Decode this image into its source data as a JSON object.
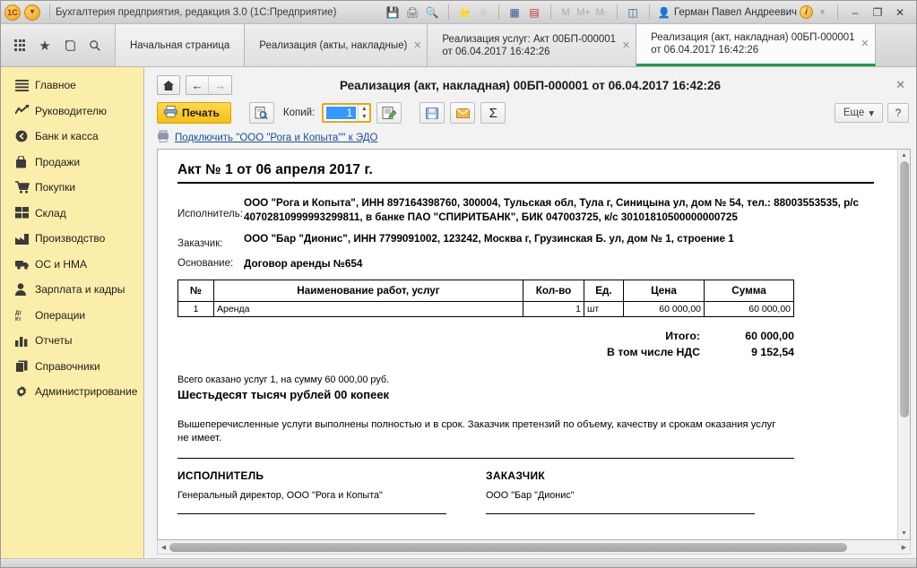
{
  "titlebar": {
    "app_title": "Бухгалтерия предприятия, редакция 3.0  (1С:Предприятие)",
    "icons": [
      "save-icon",
      "print-icon",
      "print-preview-icon",
      "favorites-add-icon",
      "favorites-icon",
      "calculator-icon",
      "calendar-icon"
    ],
    "memory_buttons": [
      "M",
      "M+",
      "M-"
    ],
    "window_split_icon": "split-window-icon",
    "user_name": "Герман Павел Андреевич",
    "info_icon": "info-icon",
    "dropdown_icon": "chevron-down-icon",
    "minimize": "–",
    "maximize": "❐",
    "close": "✕"
  },
  "quickbar": {
    "items": [
      {
        "name": "menu-grid-icon",
        "glyph": "grid"
      },
      {
        "name": "favorites-star-icon",
        "glyph": "★"
      },
      {
        "name": "history-icon",
        "glyph": "history"
      },
      {
        "name": "search-icon",
        "glyph": "search"
      }
    ]
  },
  "tabs": [
    {
      "line1": "Начальная страница",
      "line2": "",
      "active": false,
      "closable": false
    },
    {
      "line1": "Реализация (акты, накладные)",
      "line2": "",
      "active": false,
      "closable": true
    },
    {
      "line1": "Реализация услуг: Акт 00БП-000001",
      "line2": "от 06.04.2017 16:42:26",
      "active": false,
      "closable": true
    },
    {
      "line1": "Реализация (акт, накладная) 00БП-000001",
      "line2": "от 06.04.2017 16:42:26",
      "active": true,
      "closable": true
    }
  ],
  "sidebar": {
    "items": [
      {
        "label": "Главное",
        "icon": "main-menu-icon"
      },
      {
        "label": "Руководителю",
        "icon": "chart-trend-icon"
      },
      {
        "label": "Банк и касса",
        "icon": "bank-coin-icon"
      },
      {
        "label": "Продажи",
        "icon": "sales-bag-icon"
      },
      {
        "label": "Покупки",
        "icon": "purchases-cart-icon"
      },
      {
        "label": "Склад",
        "icon": "warehouse-grid-icon"
      },
      {
        "label": "Производство",
        "icon": "factory-icon"
      },
      {
        "label": "ОС и НМА",
        "icon": "truck-icon"
      },
      {
        "label": "Зарплата и кадры",
        "icon": "person-icon"
      },
      {
        "label": "Операции",
        "icon": "debit-credit-icon"
      },
      {
        "label": "Отчеты",
        "icon": "bar-chart-icon"
      },
      {
        "label": "Справочники",
        "icon": "books-icon"
      },
      {
        "label": "Администрирование",
        "icon": "gear-icon"
      }
    ]
  },
  "form": {
    "title": "Реализация (акт, накладная) 00БП-000001 от 06.04.2017 16:42:26",
    "home_icon": "home-icon",
    "back_icon": "back-arrow-icon",
    "forward_icon": "forward-arrow-icon",
    "close_icon": "close-icon",
    "print_button": "Печать",
    "print_icon": "printer-icon",
    "preview_icon": "print-preview-icon",
    "copies_label": "Копий:",
    "copies_value": "1",
    "edit_icon": "edit-document-icon",
    "save_icon": "save-icon",
    "mail_icon": "mail-icon",
    "sum_icon": "Σ",
    "more_button": "Еще",
    "more_caret": "▾",
    "help_button": "?",
    "edo_link": "Подключить \"ООО \"Рога и Копыта\"\" к ЭДО",
    "edo_icon": "edo-icon"
  },
  "document": {
    "title": "Акт № 1 от 06 апреля 2017 г.",
    "executor_label": "Исполнитель:",
    "executor_value": "ООО \"Рога и Копыта\", ИНН 897164398760, 300004, Тульская обл, Тула г, Синицына ул, дом № 54, тел.: 88003553535, р/с 40702810999993299811, в банке ПАО \"СПИРИТБАНК\", БИК 047003725, к/с 30101810500000000725",
    "customer_label": "Заказчик:",
    "customer_value": "ООО \"Бар \"Дионис\", ИНН 7799091002, 123242, Москва г, Грузинская Б. ул, дом № 1, строение 1",
    "basis_label": "Основание:",
    "basis_value": "Договор аренды №654",
    "table": {
      "headers": [
        "№",
        "Наименование работ, услуг",
        "Кол-во",
        "Ед.",
        "Цена",
        "Сумма"
      ],
      "rows": [
        {
          "num": "1",
          "name": "Аренда",
          "qty": "1",
          "unit": "шт",
          "price": "60 000,00",
          "sum": "60 000,00"
        }
      ]
    },
    "totals": [
      {
        "label": "Итого:",
        "value": "60 000,00"
      },
      {
        "label": "В том числе НДС",
        "value": "9 152,54"
      }
    ],
    "summary_small": "Всего оказано услуг 1, на сумму 60 000,00 руб.",
    "summary_big": "Шестьдесят тысяч рублей 00 копеек",
    "clause": "Вышеперечисленные услуги выполнены полностью и в срок. Заказчик претензий по объему, качеству и срокам оказания услуг не имеет.",
    "signatures": [
      {
        "title": "ИСПОЛНИТЕЛЬ",
        "text": "Генеральный директор, ООО \"Рога и Копыта\""
      },
      {
        "title": "ЗАКАЗЧИК",
        "text": "ООО \"Бар \"Дионис\""
      }
    ]
  }
}
